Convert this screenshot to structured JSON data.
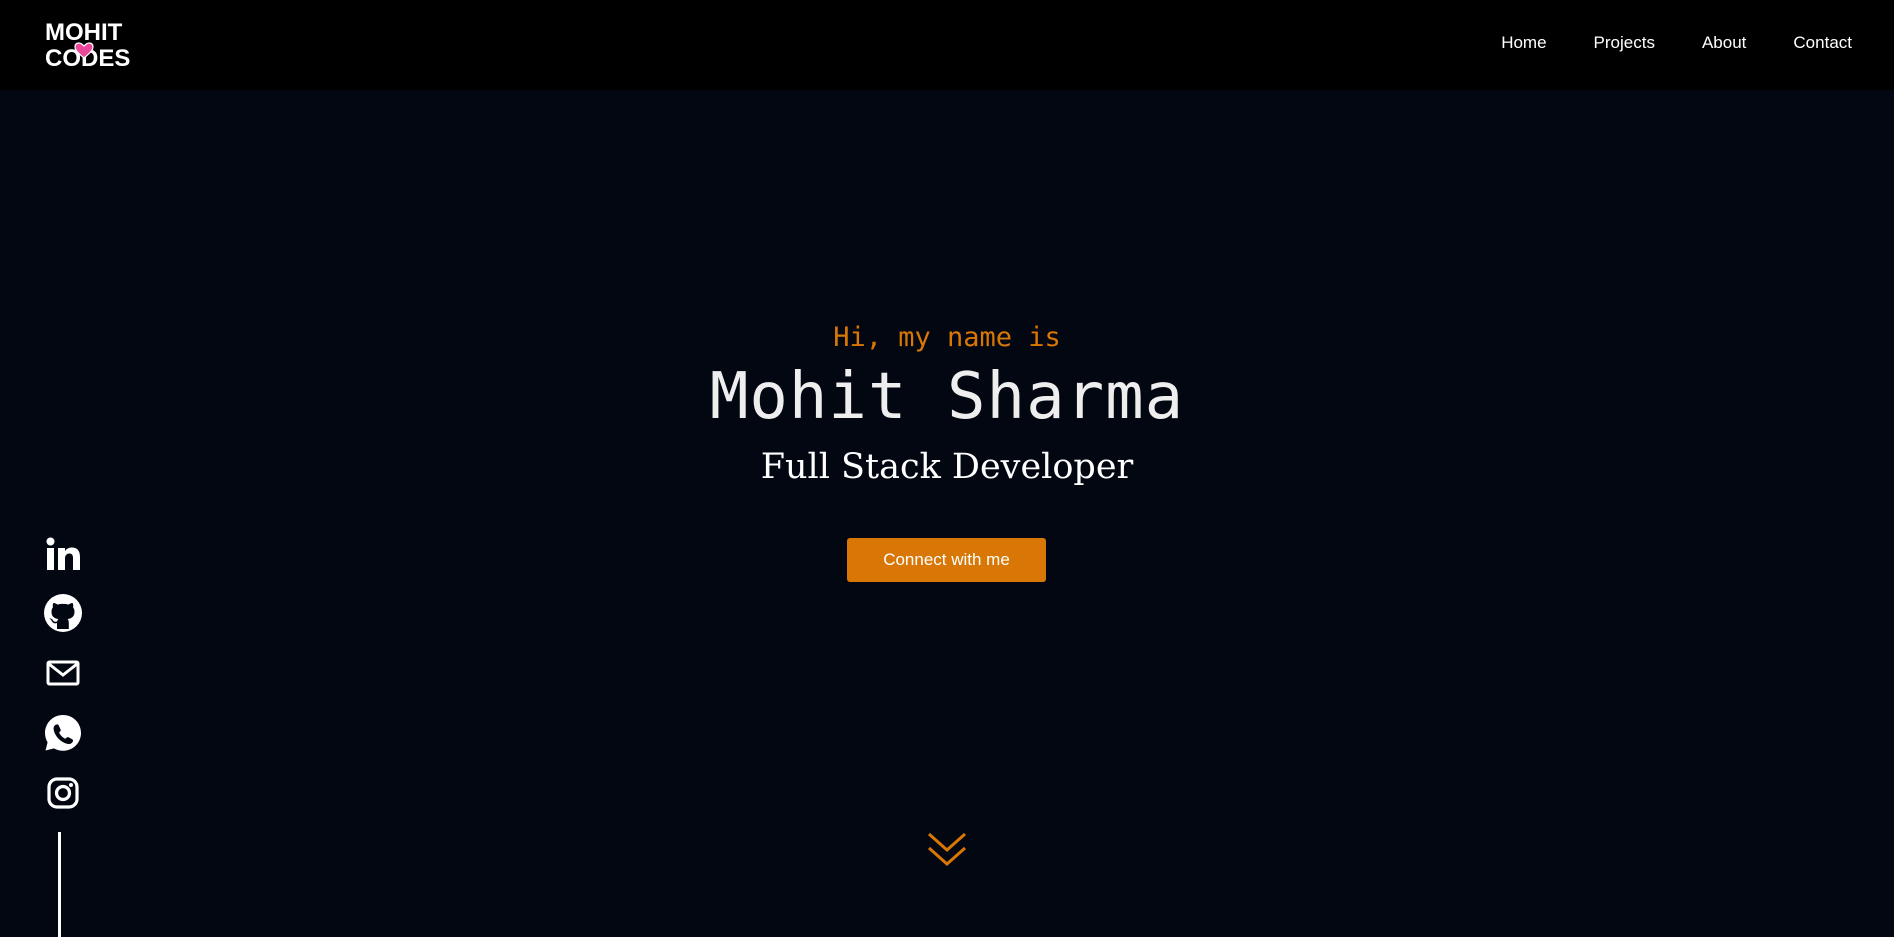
{
  "brand": {
    "logo_line1": "MOHIT",
    "logo_line2": "CODES"
  },
  "nav": {
    "items": [
      {
        "label": "Home"
      },
      {
        "label": "Projects"
      },
      {
        "label": "About"
      },
      {
        "label": "Contact"
      }
    ]
  },
  "hero": {
    "greeting": "Hi, my name is",
    "name": "Mohit Sharma",
    "role": "Full Stack Developer",
    "cta_label": "Connect with me"
  },
  "socials": [
    {
      "icon": "linkedin-icon"
    },
    {
      "icon": "github-icon"
    },
    {
      "icon": "mail-icon"
    },
    {
      "icon": "whatsapp-icon"
    },
    {
      "icon": "instagram-icon"
    }
  ],
  "colors": {
    "background": "#030712",
    "navbar": "#000000",
    "accent": "#d97706",
    "text": "#ffffff",
    "logo_heart": "#ec4899"
  }
}
